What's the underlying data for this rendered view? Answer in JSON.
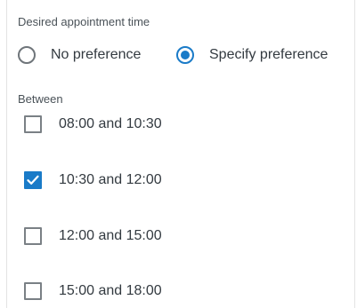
{
  "appointment_time": {
    "heading": "Desired appointment time",
    "options": [
      {
        "label": "No preference",
        "selected": false
      },
      {
        "label": "Specify preference",
        "selected": true
      }
    ]
  },
  "between": {
    "heading": "Between",
    "slots": [
      {
        "label": "08:00 and 10:30",
        "checked": false
      },
      {
        "label": "10:30 and 12:00",
        "checked": true
      },
      {
        "label": "12:00 and 15:00",
        "checked": false
      },
      {
        "label": "15:00 and 18:00",
        "checked": false
      }
    ]
  },
  "colors": {
    "accent": "#1a7bc8",
    "text": "#333a40",
    "border": "#7a8085"
  },
  "icons": {
    "checkmark": "check-icon"
  }
}
